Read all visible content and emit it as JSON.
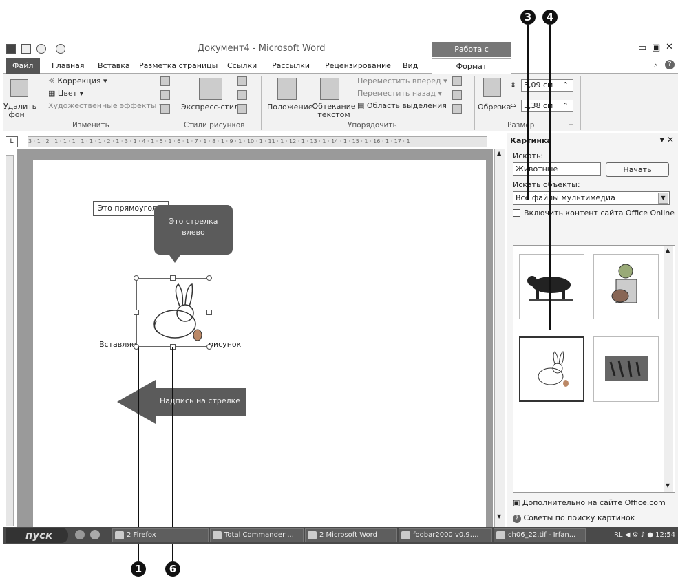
{
  "callouts": {
    "c1": "1",
    "c3": "3",
    "c4": "4",
    "c6": "6"
  },
  "window": {
    "title": "Документ4 - Microsoft Word",
    "context_tab": "Работа с рисунками"
  },
  "tabs": [
    "Файл",
    "Главная",
    "Вставка",
    "Разметка страницы",
    "Ссылки",
    "Рассылки",
    "Рецензирование",
    "Вид",
    "Формат"
  ],
  "ribbon": {
    "remove_bg": "Удалить фон",
    "correction": "Коррекция",
    "color": "Цвет",
    "art_effects": "Художественные эффекты",
    "group_change": "Изменить",
    "express_styles": "Экспресс-стили",
    "group_styles": "Стили рисунков",
    "position": "Положение",
    "wrap_text": "Обтекание текстом",
    "bring_forward": "Переместить вперед",
    "send_backward": "Переместить назад",
    "selection_pane": "Область выделения",
    "group_arrange": "Упорядочить",
    "crop": "Обрезка",
    "height": "3,09 см",
    "width": "3,38 см",
    "group_size": "Размер"
  },
  "ruler_text": "3 · 1 · 2 · 1 · 1 · 1 · 1 · 1 · 1 · 2 · 1 · 3 · 1 · 4 · 1 · 5 · 1 · 6 · 1 · 7 · 1 · 8 · 1 · 9 · 1 · 10 · 1 · 11 · 1 · 12 · 1 · 13 · 1 · 14 · 1 · 15 · 1 · 16 · 1 · 17 · 1",
  "document": {
    "rect_text": "Это прямоугольник",
    "callout_text": "Это стрелка влево",
    "wrap_left": "Вставляем",
    "wrap_right": "рисунок",
    "arrow_text": "Надпись на стрелке"
  },
  "pane": {
    "title": "Картинка",
    "search_label": "Искать:",
    "search_value": "Животные",
    "start_button": "Начать",
    "objects_label": "Искать объекты:",
    "objects_value": "Все файлы мультимедиа",
    "include_online": "Включить контент сайта Office Online",
    "more_link": "Дополнительно на сайте Office.com",
    "tips_link": "Советы по поиску картинок"
  },
  "taskbar": {
    "start": "пуск",
    "items": [
      "2 Firefox",
      "Total Commander ...",
      "2 Microsoft Word",
      "foobar2000 v0.9....",
      "ch06_22.tif - Irfan..."
    ],
    "lang": "RL",
    "time": "12:54"
  }
}
